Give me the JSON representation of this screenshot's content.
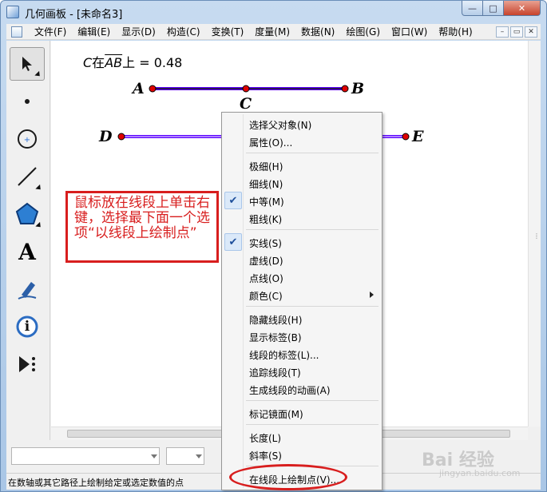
{
  "window": {
    "title": "几何画板 - [未命名3]",
    "min_glyph": "—",
    "max_glyph": "□",
    "close_glyph": "✕"
  },
  "menubar": {
    "items": [
      "文件(F)",
      "编辑(E)",
      "显示(D)",
      "构造(C)",
      "变换(T)",
      "度量(M)",
      "数据(N)",
      "绘图(G)",
      "窗口(W)",
      "帮助(H)"
    ],
    "mdi_min": "–",
    "mdi_restore": "▭",
    "mdi_close": "✕"
  },
  "toolbox": {
    "text_tool_glyph": "A",
    "info_tool_glyph": "i"
  },
  "canvas": {
    "readout": {
      "point": "C",
      "on_text": "在",
      "segment": "AB",
      "suffix": "上 = 0.48"
    },
    "points": {
      "A": "A",
      "B": "B",
      "C": "C",
      "D": "D",
      "E": "E"
    },
    "line_color": "#5a00ff",
    "point_color": "#e00000"
  },
  "annotation": {
    "text": "鼠标放在线段上单击右键，选择最下面一个选项“以线段上绘制点”",
    "color": "#d81e1e"
  },
  "context_menu": {
    "groups": [
      [
        {
          "label": "选择父对象(N)"
        },
        {
          "label": "属性(O)..."
        }
      ],
      [
        {
          "label": "极细(H)"
        },
        {
          "label": "细线(N)"
        },
        {
          "label": "中等(M)",
          "checked": true
        },
        {
          "label": "粗线(K)"
        }
      ],
      [
        {
          "label": "实线(S)",
          "checked": true
        },
        {
          "label": "虚线(D)"
        },
        {
          "label": "点线(O)"
        },
        {
          "label": "颜色(C)",
          "submenu": true
        }
      ],
      [
        {
          "label": "隐藏线段(H)"
        },
        {
          "label": "显示标签(B)"
        },
        {
          "label": "线段的标签(L)..."
        },
        {
          "label": "追踪线段(T)"
        },
        {
          "label": "生成线段的动画(A)"
        }
      ],
      [
        {
          "label": "标记镜面(M)"
        }
      ],
      [
        {
          "label": "长度(L)"
        },
        {
          "label": "斜率(S)"
        }
      ],
      [
        {
          "label": "在线段上绘制点(V)...",
          "highlighted": true
        }
      ]
    ],
    "check_glyph": "✔"
  },
  "status": {
    "text": "在数轴或其它路径上绘制给定或选定数值的点"
  },
  "watermark": {
    "main": "Bai 经验",
    "sub": "jingyan.baidu.com"
  }
}
